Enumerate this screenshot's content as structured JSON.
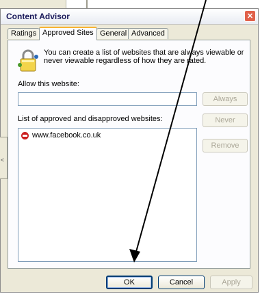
{
  "dialog": {
    "title": "Content Advisor",
    "close_glyph": "✕",
    "tabs": [
      {
        "label": "Ratings"
      },
      {
        "label": "Approved Sites"
      },
      {
        "label": "General"
      },
      {
        "label": "Advanced"
      }
    ],
    "active_tab": "Approved Sites",
    "info_text": "You can create a list of websites that are always viewable or never viewable regardless of how they are rated.",
    "allow_label": "Allow this website:",
    "allow_input_value": "",
    "list_label": "List of approved and disapproved websites:",
    "sites": [
      {
        "url": "www.facebook.co.uk",
        "status": "never",
        "icon": "deny-icon"
      }
    ],
    "buttons": {
      "always": "Always",
      "never": "Never",
      "remove": "Remove",
      "ok": "OK",
      "cancel": "Cancel",
      "apply": "Apply"
    }
  },
  "colors": {
    "dialog_bg": "#ece9d8",
    "active_tab_accent": "#f8b332",
    "close_button": "#e0614a",
    "arrow": "#000000"
  }
}
